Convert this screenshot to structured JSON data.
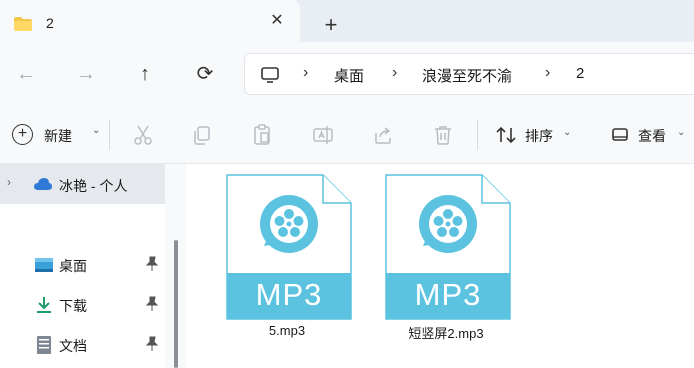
{
  "tab": {
    "title": "2",
    "close": "✕",
    "new_tab": "+"
  },
  "nav": {
    "back": "←",
    "forward": "→",
    "up": "↑",
    "refresh": "⟳"
  },
  "breadcrumb": [
    "桌面",
    "浪漫至死不渝",
    "2"
  ],
  "breadcrumb_sep": "›",
  "toolbar": {
    "new_label": "新建",
    "sort_label": "排序",
    "view_label": "查看",
    "chevron": "⌄"
  },
  "sidebar": {
    "selected": {
      "label": "冰艳 - 个人",
      "expand": "›"
    },
    "items": [
      {
        "label": "桌面",
        "icon": "desktop-icon"
      },
      {
        "label": "下载",
        "icon": "download-icon"
      },
      {
        "label": "文档",
        "icon": "document-icon"
      }
    ]
  },
  "files": [
    {
      "name": "5.mp3",
      "badge": "MP3"
    },
    {
      "name": "短竖屏2.mp3",
      "badge": "MP3"
    }
  ],
  "colors": {
    "file_accent": "#5bc3e0",
    "folder": "#f2c84b",
    "cloud": "#2f7ad6"
  }
}
